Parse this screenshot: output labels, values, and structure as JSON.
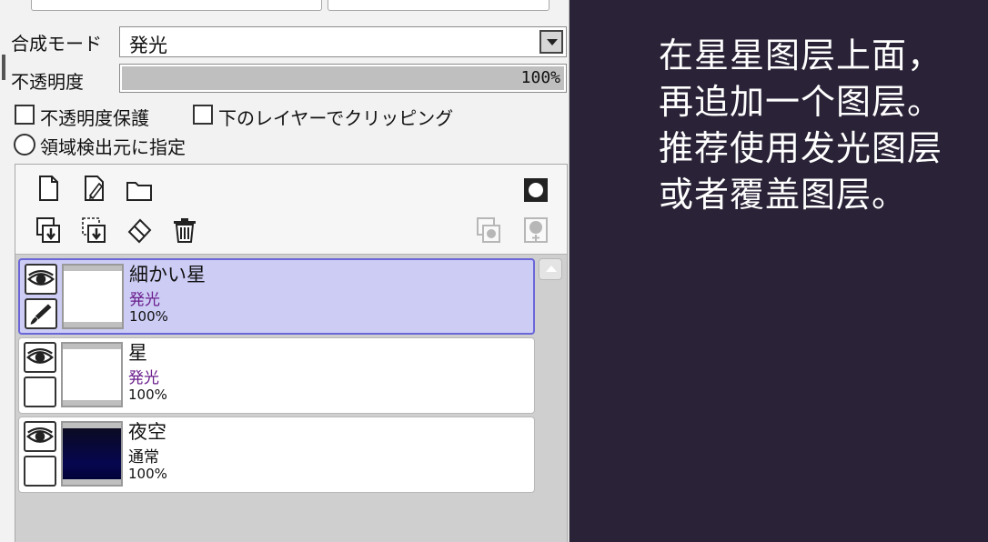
{
  "panel": {
    "blend_mode": {
      "label": "合成モード",
      "value": "発光"
    },
    "opacity": {
      "label": "不透明度",
      "value": "100%",
      "level": 1.0
    },
    "protect_opacity": {
      "label": "不透明度保護",
      "checked": false
    },
    "clipping": {
      "label": "下のレイヤーでクリッピング",
      "checked": false
    },
    "selection_source": {
      "label": "領域検出元に指定",
      "checked": false
    }
  },
  "layers": [
    {
      "name": "細かい星",
      "mode": "発光",
      "opacity": "100%",
      "selected": true,
      "visible": true,
      "thumb": "white"
    },
    {
      "name": "星",
      "mode": "発光",
      "opacity": "100%",
      "selected": false,
      "visible": true,
      "thumb": "white"
    },
    {
      "name": "夜空",
      "mode": "通常",
      "opacity": "100%",
      "selected": false,
      "visible": true,
      "thumb": "dark"
    }
  ],
  "toolbar_icons": [
    "new-layer-icon",
    "new-linework-layer-icon",
    "new-folder-icon",
    "mask-icon",
    "transfer-down-icon",
    "merge-down-icon",
    "clear-layer-icon",
    "delete-layer-icon",
    "apply-mask-icon",
    "add-mask-icon"
  ],
  "caption": {
    "lines": [
      "在星星图层上面，",
      "再追加一个图层。",
      "推荐使用发光图层",
      "或者覆盖图层。"
    ]
  },
  "colors": {
    "background": "#2a2236",
    "panel": "#f2f2f2",
    "selected_row": "#ccccf5",
    "selected_border": "#6a66d8",
    "mode_text": "#6a1d8c",
    "caption_text": "#ffffff"
  }
}
